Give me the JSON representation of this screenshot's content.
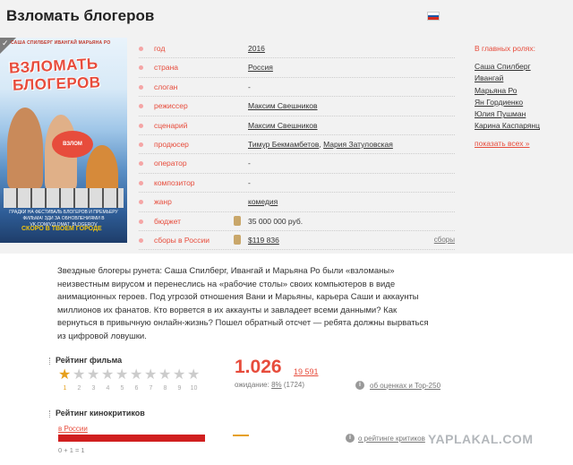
{
  "page": {
    "title": "Взломать блогеров",
    "flag_colors": [
      "#ffffff",
      "#1c57a7",
      "#d52b1e"
    ]
  },
  "poster": {
    "cast_names": "САША СПИЛБЕРГ  ИВАНГАЙ  МАРЬЯНА РО",
    "title_line1": "ВЗЛОМАТЬ",
    "title_line2": "БЛОГЕРОВ",
    "badge": "ВЗЛОМ",
    "festival": "ГРАДКИ НА ФЕСТИВАЛЬ БЛОГЕРОВ И ПРЕМЬЕРУ ФИЛЬМА! ЗДИ ЗА ОБНОВЛЕНИЯМИ В VK.COM/VZLOMAT_BLOGEROV",
    "soon": "СКОРО В ТВОЕМ ГОРОДЕ"
  },
  "info": {
    "rows": [
      {
        "label": "год",
        "value": "2016"
      },
      {
        "label": "страна",
        "value": "Россия"
      },
      {
        "label": "слоган",
        "value": "-"
      },
      {
        "label": "режиссер",
        "value": "Максим Свешников"
      },
      {
        "label": "сценарий",
        "value": "Максим Свешников"
      },
      {
        "label": "продюсер",
        "value": "Тимур Бекмамбетов",
        "value2": "Мария Затуловская"
      },
      {
        "label": "оператор",
        "value": "-"
      },
      {
        "label": "композитор",
        "value": "-"
      },
      {
        "label": "жанр",
        "value": "комедия"
      },
      {
        "label": "бюджет",
        "value": "35 000 000 руб."
      },
      {
        "label": "сборы в России",
        "value": "$119 836",
        "extra_link": "сборы"
      }
    ],
    "comma": ","
  },
  "roles": {
    "heading": "В главных ролях:",
    "actors": [
      "Саша Спилберг",
      "Ивангай",
      "Марьяна Ро",
      "Ян Гордиенко",
      "Юлия Пушман",
      "Карина Каспарянц"
    ],
    "show_all": "показать всех »"
  },
  "description": "Звездные блогеры рунета: Саша Спилберг, Ивангай и Марьяна Ро были «взломаны» неизвестным вирусом и перенеслись на «рабочие столы» своих компьютеров в виде анимационных героев. Под угрозой отношения Вани и Марьяны, карьера Саши и аккаунты миллионов их фанатов. Кто ворвется в их аккаунты и завладеет всеми данными? Как вернуться в привычную онлайн-жизнь? Пошел обратный отсчет — ребята должны вырваться из цифровой ловушки.",
  "rating": {
    "heading": "Рейтинг фильма",
    "star_labels": [
      "1",
      "2",
      "3",
      "4",
      "5",
      "6",
      "7",
      "8",
      "9",
      "10"
    ],
    "selected_stars": 1,
    "value": "1.026",
    "votes": "19 591",
    "waiting_label": "ожидание:",
    "waiting_pct": "8%",
    "waiting_count": "(1724)",
    "about_link": "об оценках и Top-250",
    "star_color_on": "#e6a01e"
  },
  "critics": {
    "heading": "Рейтинг кинокритиков",
    "region_link": "в России",
    "counts": "0 + 1 = 1",
    "about_link": "о рейтинге критиков",
    "bar_color": "#d01f1f"
  },
  "watermark": "YAPLAKAL.COM"
}
